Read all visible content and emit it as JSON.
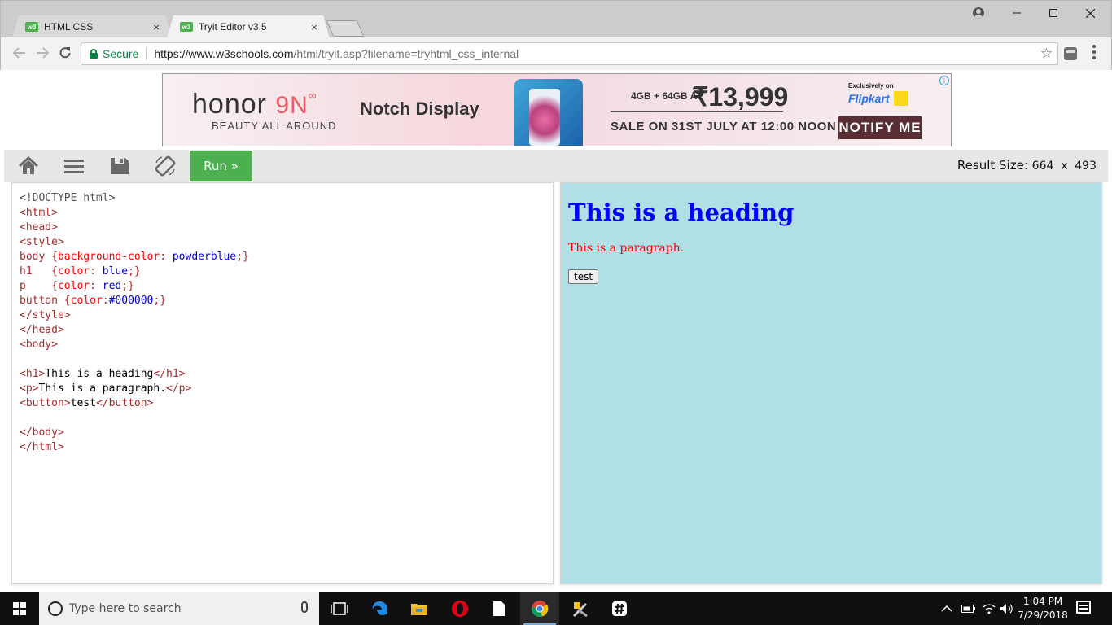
{
  "browser": {
    "tabs": [
      {
        "favicon": "w3",
        "title": "HTML CSS",
        "close": "×"
      },
      {
        "favicon": "w3",
        "title": "Tryit Editor v3.5",
        "close": "×"
      }
    ],
    "window_controls": {
      "minimize": "—",
      "maximize": "☐",
      "close": "✕"
    },
    "omnibox": {
      "secure_label": "Secure",
      "url_host": "https://www.w3schools.com",
      "url_path": "/html/tryit.asp?filename=tryhtml_css_internal"
    }
  },
  "ad": {
    "brand": "honor",
    "model": "9N",
    "model_suffix": "∞",
    "tagline": "BEAUTY ALL AROUND",
    "feature": "Notch Display",
    "spec": "4GB + 64GB AT",
    "price": "₹13,999",
    "sale_text": "SALE ON 31ST JULY AT 12:00 NOON",
    "exclusive": "Exclusively on",
    "partner": "Flipkart",
    "cta": "NOTIFY ME",
    "info": "i"
  },
  "editor_toolbar": {
    "run_label": "Run »",
    "result_size_label": "Result Size:",
    "result_width": "664",
    "result_x": "x",
    "result_height": "493"
  },
  "code": {
    "doctype": "<!DOCTYPE html>",
    "html_open": "<html>",
    "head_open": "<head>",
    "style_open": "<style>",
    "body_sel": "body",
    "body_prop": "background-color",
    "body_val": "powderblue",
    "h1_sel": "h1",
    "h1_prop": "color",
    "h1_val": "blue",
    "p_sel": "p",
    "p_prop": "color",
    "p_val": "red",
    "button_sel": "button",
    "button_prop": "color",
    "button_val": "#000000",
    "style_close": "</style>",
    "head_close": "</head>",
    "body_open": "<body>",
    "h1_open": "<h1>",
    "h1_text": "This is a heading",
    "h1_close": "</h1>",
    "p_open": "<p>",
    "p_text": "This is a paragraph.",
    "p_close": "</p>",
    "btn_open": "<button>",
    "btn_text": "test",
    "btn_close": "</button>",
    "body_close": "</body>",
    "html_close": "</html>"
  },
  "result": {
    "heading": "This is a heading",
    "paragraph": "This is a paragraph.",
    "button": "test"
  },
  "taskbar": {
    "search_placeholder": "Type here to search",
    "time": "1:04 PM",
    "date": "7/29/2018",
    "pinned": [
      "task-view-icon",
      "edge-icon",
      "file-explorer-icon",
      "opera-icon",
      "file-icon",
      "chrome-icon",
      "tools-icon",
      "slack-icon"
    ]
  }
}
